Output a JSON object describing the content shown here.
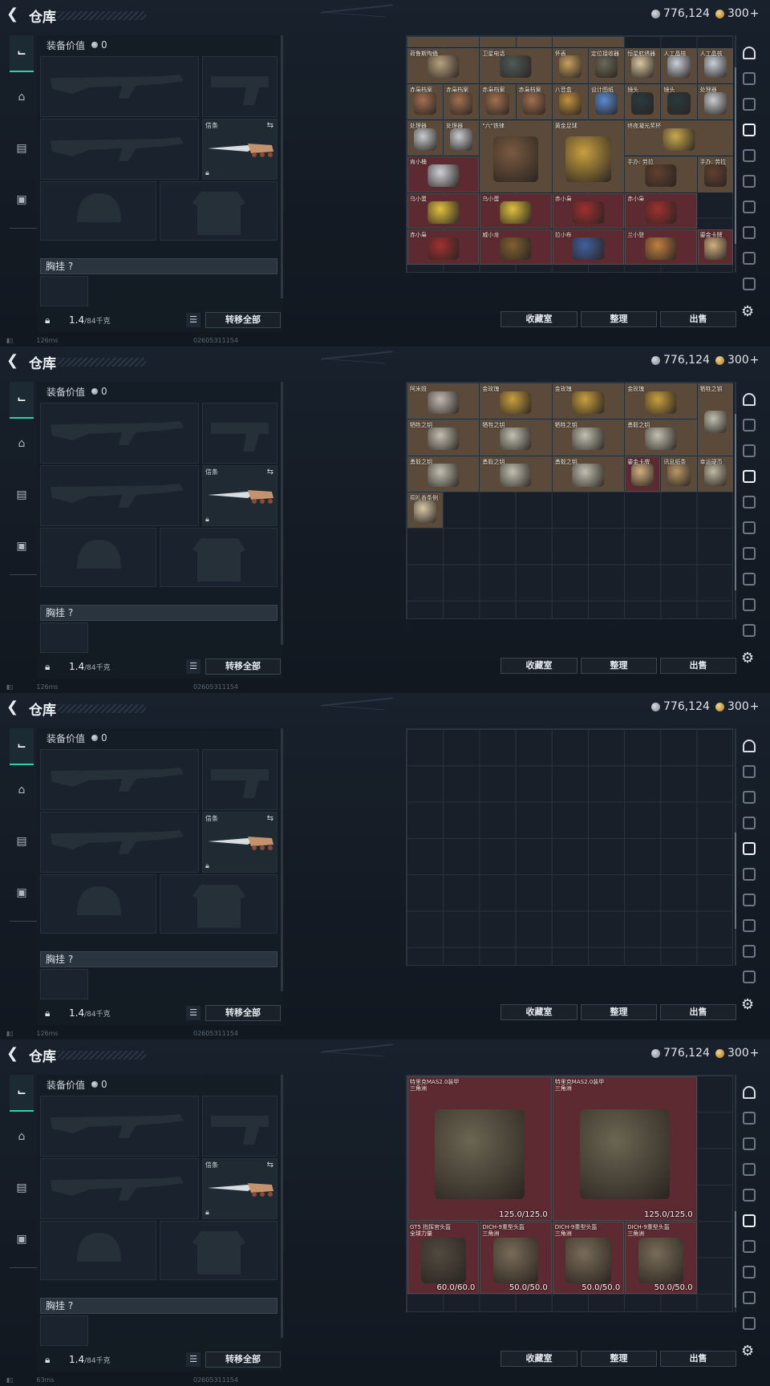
{
  "panels": [
    {
      "title": "仓库",
      "currency": {
        "silver": "776,124",
        "gold": "300"
      },
      "equip_value_label": "装备价值",
      "equip_value": "0",
      "knife_name": "信条",
      "chest_label": "胸挂 ?",
      "weight": "1.4",
      "weight_max": "/84千克",
      "transfer_label": "转移全部",
      "btn_collection": "收藏室",
      "btn_sort": "整理",
      "btn_sell": "出售",
      "ping": "126ms",
      "uid": "02605311154",
      "right_tab_active": 3,
      "grid_items": [
        {
          "name": "",
          "c": 0,
          "r": 0,
          "w": 2,
          "h": 0.3,
          "tone": "tan"
        },
        {
          "name": "",
          "c": 2,
          "r": 0,
          "w": 1,
          "h": 0.3,
          "tone": "tan"
        },
        {
          "name": "",
          "c": 3,
          "r": 0,
          "w": 1,
          "h": 0.3,
          "tone": "tan"
        },
        {
          "name": "",
          "c": 4,
          "r": 0,
          "w": 2,
          "h": 0.3,
          "tone": "tan"
        },
        {
          "name": "荷鲁斯陶俑",
          "c": 0,
          "r": 0.3,
          "w": 2,
          "h": 1,
          "tone": "tan",
          "obj": "#b7a07e"
        },
        {
          "name": "卫星电话",
          "c": 2,
          "r": 0.3,
          "w": 2,
          "h": 1,
          "tone": "tan",
          "obj": "#4f5a56"
        },
        {
          "name": "怀表",
          "c": 4,
          "r": 0.3,
          "w": 1,
          "h": 1,
          "tone": "tan",
          "obj": "#c8a060"
        },
        {
          "name": "定位接收器",
          "c": 5,
          "r": 0.3,
          "w": 1,
          "h": 1,
          "tone": "tan",
          "obj": "#6a6a5a"
        },
        {
          "name": "恒星航绣器",
          "c": 6,
          "r": 0.3,
          "w": 1,
          "h": 1,
          "tone": "tan",
          "obj": "#d8c8a0"
        },
        {
          "name": "人工晶核",
          "c": 7,
          "r": 0.3,
          "w": 1,
          "h": 1,
          "tone": "tan",
          "obj": "#c8d0d8"
        },
        {
          "name": "人工晶核",
          "c": 8,
          "r": 0.3,
          "w": 1,
          "h": 1,
          "tone": "tan",
          "obj": "#c8d0d8"
        },
        {
          "name": "赤枭档案",
          "c": 0,
          "r": 1.3,
          "w": 1,
          "h": 1,
          "tone": "tan",
          "obj": "#a07050"
        },
        {
          "name": "赤枭档案",
          "c": 1,
          "r": 1.3,
          "w": 1,
          "h": 1,
          "tone": "tan",
          "obj": "#a07050"
        },
        {
          "name": "赤枭档案",
          "c": 2,
          "r": 1.3,
          "w": 1,
          "h": 1,
          "tone": "tan",
          "obj": "#a07050"
        },
        {
          "name": "赤枭档案",
          "c": 3,
          "r": 1.3,
          "w": 1,
          "h": 1,
          "tone": "tan",
          "obj": "#a07050"
        },
        {
          "name": "八音盒",
          "c": 4,
          "r": 1.3,
          "w": 1,
          "h": 1,
          "tone": "tan",
          "obj": "#c09040"
        },
        {
          "name": "设计图纸",
          "c": 5,
          "r": 1.3,
          "w": 1,
          "h": 1,
          "tone": "tan",
          "obj": "#5a8ad0"
        },
        {
          "name": "镜头",
          "c": 6,
          "r": 1.3,
          "w": 1,
          "h": 1,
          "tone": "tan",
          "obj": "#2a3a40"
        },
        {
          "name": "镜头",
          "c": 7,
          "r": 1.3,
          "w": 1,
          "h": 1,
          "tone": "tan",
          "obj": "#2a3a40"
        },
        {
          "name": "处理器",
          "c": 8,
          "r": 1.3,
          "w": 1,
          "h": 1,
          "tone": "tan",
          "obj": "#c8ccd0"
        },
        {
          "name": "处理器",
          "c": 0,
          "r": 2.3,
          "w": 1,
          "h": 1,
          "tone": "tan",
          "obj": "#c8ccd0"
        },
        {
          "name": "处理器",
          "c": 1,
          "r": 2.3,
          "w": 1,
          "h": 1,
          "tone": "tan",
          "obj": "#c8ccd0"
        },
        {
          "name": "\"六\"铁律",
          "c": 2,
          "r": 2.3,
          "w": 2,
          "h": 2,
          "tone": "tan",
          "obj": "#7a5a40"
        },
        {
          "name": "黄金足球",
          "c": 4,
          "r": 2.3,
          "w": 2,
          "h": 2,
          "tone": "tan",
          "obj": "#c8a040"
        },
        {
          "name": "终夜凝光奖杯",
          "c": 6,
          "r": 2.3,
          "w": 3,
          "h": 1,
          "tone": "tan",
          "obj": "#c8a850"
        },
        {
          "name": "肯小桶",
          "c": 0,
          "r": 3.3,
          "w": 2,
          "h": 1,
          "tone": "red",
          "obj": "#d0d0d8"
        },
        {
          "name": "手办: 劳拉",
          "c": 6,
          "r": 3.3,
          "w": 2,
          "h": 1,
          "tone": "tan",
          "obj": "#604030"
        },
        {
          "name": "手办: 劳拉",
          "c": 8,
          "r": 3.3,
          "w": 1,
          "h": 1,
          "tone": "tan",
          "obj": "#604030"
        },
        {
          "name": "乌小蛋",
          "c": 0,
          "r": 4.3,
          "w": 2,
          "h": 1,
          "tone": "red",
          "obj": "#e0c040"
        },
        {
          "name": "乌小蛋",
          "c": 2,
          "r": 4.3,
          "w": 2,
          "h": 1,
          "tone": "red",
          "obj": "#e0c040"
        },
        {
          "name": "赤小枭",
          "c": 4,
          "r": 4.3,
          "w": 2,
          "h": 1,
          "tone": "red",
          "obj": "#a03030"
        },
        {
          "name": "赤小枭",
          "c": 6,
          "r": 4.3,
          "w": 2,
          "h": 1,
          "tone": "red",
          "obj": "#a03030"
        },
        {
          "name": "赤小枭",
          "c": 0,
          "r": 5.3,
          "w": 2,
          "h": 1,
          "tone": "red",
          "obj": "#a03030"
        },
        {
          "name": "威小龙",
          "c": 2,
          "r": 5.3,
          "w": 2,
          "h": 1,
          "tone": "red",
          "obj": "#806030"
        },
        {
          "name": "拉小布",
          "c": 4,
          "r": 5.3,
          "w": 2,
          "h": 1,
          "tone": "red",
          "obj": "#4060a0"
        },
        {
          "name": "兰小登",
          "c": 6,
          "r": 5.3,
          "w": 2,
          "h": 1,
          "tone": "red",
          "obj": "#c08040"
        },
        {
          "name": "鎏金卡牌",
          "c": 8,
          "r": 5.3,
          "w": 1,
          "h": 1,
          "tone": "red",
          "obj": "#d0b080"
        }
      ]
    },
    {
      "title": "仓库",
      "currency": {
        "silver": "776,124",
        "gold": "300"
      },
      "equip_value_label": "装备价值",
      "equip_value": "0",
      "knife_name": "信条",
      "chest_label": "胸挂 ?",
      "weight": "1.4",
      "weight_max": "/84千克",
      "transfer_label": "转移全部",
      "btn_collection": "收藏室",
      "btn_sort": "整理",
      "btn_sell": "出售",
      "ping": "126ms",
      "uid": "02605311154",
      "right_tab_active": 3,
      "grid_items": [
        {
          "name": "阿米娅",
          "c": 0,
          "r": 0,
          "w": 2,
          "h": 1,
          "tone": "tan",
          "obj": "#c0b8b0"
        },
        {
          "name": "金玫瑰",
          "c": 2,
          "r": 0,
          "w": 2,
          "h": 1,
          "tone": "tan",
          "obj": "#c8a040"
        },
        {
          "name": "金玫瑰",
          "c": 4,
          "r": 0,
          "w": 2,
          "h": 1,
          "tone": "tan",
          "obj": "#c8a040"
        },
        {
          "name": "金玫瑰",
          "c": 6,
          "r": 0,
          "w": 2,
          "h": 1,
          "tone": "tan",
          "obj": "#c8a040"
        },
        {
          "name": "牺牲之钥",
          "c": 8,
          "r": 0,
          "w": 1,
          "h": 2,
          "tone": "tan",
          "obj": "#c0c0b0"
        },
        {
          "name": "牺牲之钥",
          "c": 0,
          "r": 1,
          "w": 2,
          "h": 1,
          "tone": "tan",
          "obj": "#c0c0b0"
        },
        {
          "name": "牺牲之钥",
          "c": 2,
          "r": 1,
          "w": 2,
          "h": 1,
          "tone": "tan",
          "obj": "#c0c0b0"
        },
        {
          "name": "牺牲之钥",
          "c": 4,
          "r": 1,
          "w": 2,
          "h": 1,
          "tone": "tan",
          "obj": "#c0c0b0"
        },
        {
          "name": "勇毅之钥",
          "c": 6,
          "r": 1,
          "w": 2,
          "h": 1,
          "tone": "tan",
          "obj": "#c0c0b0"
        },
        {
          "name": "勇毅之钥",
          "c": 0,
          "r": 2,
          "w": 2,
          "h": 1,
          "tone": "tan",
          "obj": "#c0c0b0"
        },
        {
          "name": "勇毅之钥",
          "c": 2,
          "r": 2,
          "w": 2,
          "h": 1,
          "tone": "tan",
          "obj": "#c0c0b0"
        },
        {
          "name": "勇毅之钥",
          "c": 4,
          "r": 2,
          "w": 2,
          "h": 1,
          "tone": "tan",
          "obj": "#c0c0b0"
        },
        {
          "name": "鎏金卡牌",
          "c": 6,
          "r": 2,
          "w": 1,
          "h": 1,
          "tone": "red",
          "obj": "#d0b080"
        },
        {
          "name": "讯息纸条",
          "c": 7,
          "r": 2,
          "w": 1,
          "h": 1,
          "tone": "tan",
          "obj": "#b89868"
        },
        {
          "name": "幸运硬币",
          "c": 8,
          "r": 2,
          "w": 1,
          "h": 1,
          "tone": "tan",
          "obj": "#c0b8a0"
        },
        {
          "name": "祠礼香条例",
          "c": 0,
          "r": 3,
          "w": 1,
          "h": 1,
          "tone": "tan",
          "obj": "#d8c8a8"
        }
      ]
    },
    {
      "title": "仓库",
      "currency": {
        "silver": "776,124",
        "gold": "300"
      },
      "equip_value_label": "装备价值",
      "equip_value": "0",
      "knife_name": "信条",
      "chest_label": "胸挂 ?",
      "weight": "1.4",
      "weight_max": "/84千克",
      "transfer_label": "转移全部",
      "btn_collection": "收藏室",
      "btn_sort": "整理",
      "btn_sell": "出售",
      "ping": "126ms",
      "uid": "02605311154",
      "right_tab_active": 4,
      "grid_items": []
    },
    {
      "title": "仓库",
      "currency": {
        "silver": "776,124",
        "gold": "300"
      },
      "equip_value_label": "装备价值",
      "equip_value": "0",
      "knife_name": "信条",
      "chest_label": "胸挂 ?",
      "weight": "1.4",
      "weight_max": "/84千克",
      "transfer_label": "转移全部",
      "btn_collection": "收藏室",
      "btn_sort": "整理",
      "btn_sell": "出售",
      "ping": "63ms",
      "uid": "02605311154",
      "right_tab_active": 5,
      "grid_items": [
        {
          "name": "特里克MAS2.0装甲",
          "sub": "三角洲",
          "c": 0,
          "r": 0,
          "w": 4,
          "h": 4,
          "tone": "red",
          "obj": "#6b6552",
          "dura": "125.0/125.0"
        },
        {
          "name": "特里克MAS2.0装甲",
          "sub": "三角洲",
          "c": 4,
          "r": 0,
          "w": 4,
          "h": 4,
          "tone": "red",
          "obj": "#6b6552",
          "dura": "125.0/125.0"
        },
        {
          "name": "GT5 指挥官头盔",
          "sub": "全球力量",
          "c": 0,
          "r": 4,
          "w": 2,
          "h": 2,
          "tone": "red",
          "obj": "#504a40",
          "dura": "60.0/60.0"
        },
        {
          "name": "DICH-9重型头盔",
          "sub": "三角洲",
          "c": 2,
          "r": 4,
          "w": 2,
          "h": 2,
          "tone": "red",
          "obj": "#786c58",
          "dura": "50.0/50.0"
        },
        {
          "name": "DICH-9重型头盔",
          "sub": "三角洲",
          "c": 4,
          "r": 4,
          "w": 2,
          "h": 2,
          "tone": "red",
          "obj": "#786c58",
          "dura": "50.0/50.0"
        },
        {
          "name": "DICH-9重型头盔",
          "sub": "三角洲",
          "c": 6,
          "r": 4,
          "w": 2,
          "h": 2,
          "tone": "red",
          "obj": "#786c58",
          "dura": "50.0/50.0"
        }
      ]
    }
  ]
}
